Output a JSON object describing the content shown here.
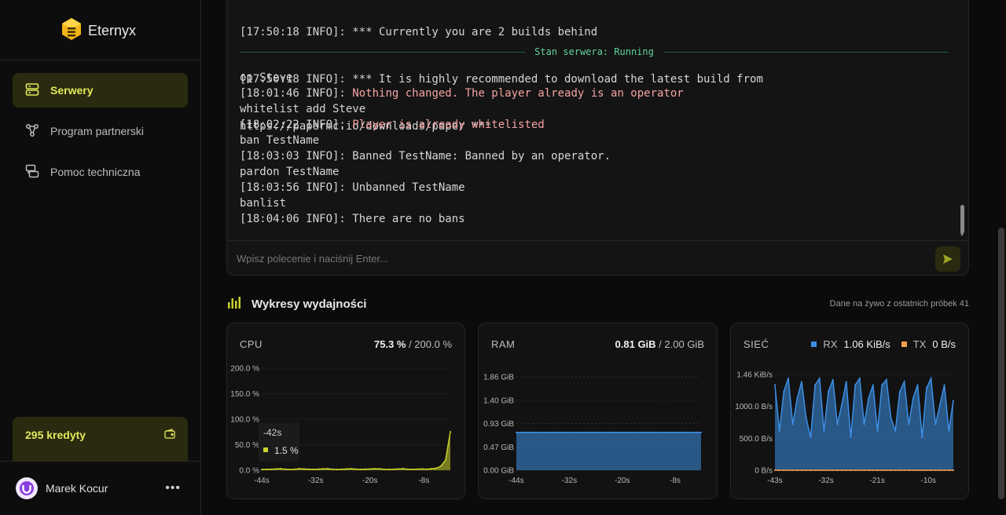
{
  "app": {
    "name": "Eternyx"
  },
  "sidebar": {
    "items": [
      {
        "label": "Serwery",
        "icon": "server-icon",
        "active": true
      },
      {
        "label": "Program partnerski",
        "icon": "share-network-icon",
        "active": false
      },
      {
        "label": "Pomoc techniczna",
        "icon": "chat-support-icon",
        "active": false
      }
    ],
    "credits": "295 kredyty",
    "user": "Marek Kocur"
  },
  "console": {
    "lines_before": [
      "[17:50:18 INFO]: *** Currently you are 2 builds behind",
      "[17:50:18 INFO]: *** It is highly recommended to download the latest build from",
      "https://papermc.io/downloads/paper ***"
    ],
    "status_text": "Stan serwera: Running",
    "lines_after": [
      {
        "prefix": "op Steve",
        "msg": "",
        "error": false
      },
      {
        "prefix": "[18:01:46 INFO]: ",
        "msg": "Nothing changed. The player already is an operator",
        "error": true
      },
      {
        "prefix": "whitelist add Steve",
        "msg": "",
        "error": false
      },
      {
        "prefix": "[18:02:22 INFO]: ",
        "msg": "Player is already whitelisted",
        "error": true
      },
      {
        "prefix": "ban TestName",
        "msg": "",
        "error": false
      },
      {
        "prefix": "[18:03:03 INFO]: Banned TestName: Banned by an operator.",
        "msg": "",
        "error": false
      },
      {
        "prefix": "pardon TestName",
        "msg": "",
        "error": false
      },
      {
        "prefix": "[18:03:56 INFO]: Unbanned TestName",
        "msg": "",
        "error": false
      },
      {
        "prefix": "banlist",
        "msg": "",
        "error": false
      },
      {
        "prefix": "[18:04:06 INFO]: There are no bans",
        "msg": "",
        "error": false
      }
    ],
    "input_placeholder": "Wpisz polecenie i naciśnij Enter..."
  },
  "performance": {
    "title": "Wykresy wydajności",
    "note": "Dane na żywo z ostatnich próbek 41"
  },
  "colors": {
    "accent": "#e3e95a",
    "cpu": "#c9d22b",
    "rx": "#3d8fe6",
    "tx": "#f5a04a",
    "status": "#5ed39b",
    "error": "#f5a3a3"
  },
  "chart_data": [
    {
      "type": "area",
      "label": "CPU",
      "current": "75.3 %",
      "max": "200.0 %",
      "y_ticks": [
        "0.0 %",
        "50.0 %",
        "100.0 %",
        "150.0 %",
        "200.0 %"
      ],
      "ylim": [
        0,
        200
      ],
      "x_ticks": [
        "-44s",
        "-32s",
        "-20s",
        "-8s"
      ],
      "tooltip": {
        "time": "-42s",
        "value": "1.5 %"
      },
      "values": [
        1.5,
        1.8,
        2,
        2.5,
        3,
        2,
        1.5,
        2,
        3,
        2.5,
        2,
        1.8,
        2.2,
        2.8,
        3,
        2,
        1.5,
        2,
        2.5,
        3,
        2.2,
        1.8,
        2,
        2.5,
        3,
        2.8,
        2,
        1.5,
        2,
        2.5,
        3,
        2,
        1.8,
        2.2,
        2.5,
        2,
        3,
        4,
        8,
        20,
        75.3
      ]
    },
    {
      "type": "area",
      "label": "RAM",
      "current": "0.81 GiB",
      "max": "2.00 GiB",
      "y_ticks": [
        "0.00 GiB",
        "0.47 GiB",
        "0.93 GiB",
        "1.40 GiB",
        "1.86 GiB"
      ],
      "ylim": [
        0,
        2.0
      ],
      "x_ticks": [
        "-44s",
        "-32s",
        "-20s",
        "-8s"
      ],
      "values": [
        0.81,
        0.81,
        0.81,
        0.81,
        0.81,
        0.81,
        0.81,
        0.81,
        0.81,
        0.81,
        0.81,
        0.81,
        0.81,
        0.81,
        0.81,
        0.81,
        0.81,
        0.81,
        0.81,
        0.81,
        0.81,
        0.81,
        0.81,
        0.81,
        0.81,
        0.81,
        0.81,
        0.81,
        0.81,
        0.81,
        0.81,
        0.81,
        0.81,
        0.81,
        0.81,
        0.81,
        0.81,
        0.81,
        0.81,
        0.81,
        0.81
      ]
    },
    {
      "type": "area",
      "label": "SIEĆ",
      "series": [
        {
          "name": "RX",
          "current": "1.06 KiB/s"
        },
        {
          "name": "TX",
          "current": "0 B/s"
        }
      ],
      "y_ticks": [
        "0 B/s",
        "500.0 B/s",
        "1000.0 B/s",
        "1.46 KiB/s"
      ],
      "ylim": [
        0,
        1.46
      ],
      "x_ticks": [
        "-43s",
        "-32s",
        "-21s",
        "-10s"
      ],
      "rx_values": [
        1.3,
        0.6,
        1.2,
        1.4,
        0.7,
        1.1,
        1.35,
        0.8,
        0.5,
        1.3,
        1.4,
        0.6,
        1.2,
        1.38,
        0.7,
        1.0,
        1.35,
        0.5,
        1.3,
        1.4,
        0.7,
        1.1,
        1.3,
        0.6,
        1.3,
        1.38,
        0.8,
        0.6,
        1.2,
        1.35,
        0.7,
        1.1,
        1.3,
        0.5,
        1.25,
        1.4,
        0.7,
        1.0,
        1.3,
        0.6,
        1.06
      ],
      "tx_values": [
        0,
        0,
        0,
        0,
        0,
        0,
        0,
        0,
        0,
        0,
        0,
        0,
        0,
        0,
        0,
        0,
        0,
        0,
        0,
        0,
        0,
        0,
        0,
        0,
        0,
        0,
        0,
        0,
        0,
        0,
        0,
        0,
        0,
        0,
        0,
        0,
        0,
        0,
        0,
        0,
        0
      ]
    }
  ]
}
